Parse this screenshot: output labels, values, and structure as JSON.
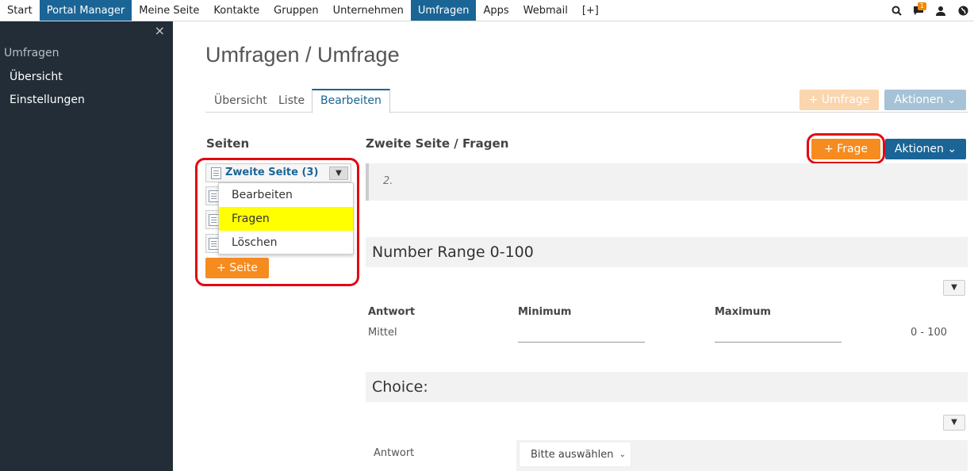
{
  "topnav": {
    "items": [
      "Start",
      "Portal Manager",
      "Meine Seite",
      "Kontakte",
      "Gruppen",
      "Unternehmen",
      "Umfragen",
      "Apps",
      "Webmail",
      "[+]"
    ],
    "badge_count": "1"
  },
  "sidebar": {
    "title": "Umfragen",
    "items": [
      "Übersicht",
      "Einstellungen"
    ],
    "close": "×"
  },
  "page": {
    "title": "Umfragen / Umfrage"
  },
  "tabs": [
    "Übersicht",
    "Liste",
    "Bearbeiten"
  ],
  "toolbar": {
    "umfrage_label": "Umfrage",
    "aktionen_label": "Aktionen"
  },
  "pages_panel": {
    "heading": "Seiten",
    "current_page": "Zweite Seite (3)",
    "menu": [
      "Bearbeiten",
      "Fragen",
      "Löschen"
    ],
    "add_label": "Seite"
  },
  "questions": {
    "heading": "Zweite Seite / Fragen",
    "frage_label": "Frage",
    "aktionen_label": "Aktionen",
    "note": "2.",
    "number_range": {
      "title": "Number Range 0-100",
      "col_answer": "Antwort",
      "col_min": "Minimum",
      "col_max": "Maximum",
      "row_label": "Mittel",
      "range": "0 - 100"
    },
    "choice": {
      "title": "Choice:",
      "answer_label": "Antwort",
      "select_value": "Bitte auswählen"
    }
  }
}
